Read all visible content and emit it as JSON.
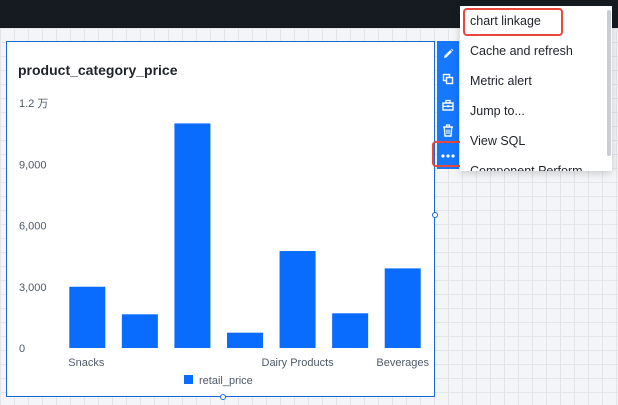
{
  "panel": {
    "title": "product_category_price"
  },
  "toolbar": {
    "buttons": [
      {
        "name": "edit",
        "icon": "pencil-icon"
      },
      {
        "name": "copy",
        "icon": "copy-icon"
      },
      {
        "name": "toolbox",
        "icon": "toolbox-icon"
      },
      {
        "name": "delete",
        "icon": "trash-icon"
      },
      {
        "name": "more",
        "icon": "ellipsis-icon"
      }
    ]
  },
  "menu": {
    "items": [
      {
        "label": "chart linkage"
      },
      {
        "label": "Cache and refresh"
      },
      {
        "label": "Metric alert"
      },
      {
        "label": "Jump to..."
      },
      {
        "label": "View SQL"
      },
      {
        "label": "Component Perform..."
      }
    ]
  },
  "colors": {
    "accent": "#1677ff",
    "bar": "#0a6cff",
    "highlight": "#e8483b",
    "topbar": "#161b22"
  },
  "chart_data": {
    "type": "bar",
    "title": "product_category_price",
    "categories": [
      "Snacks",
      "",
      "",
      "",
      "Dairy Products",
      "",
      "Beverages"
    ],
    "series": [
      {
        "name": "retail_price",
        "values": [
          3000,
          1650,
          11000,
          750,
          4750,
          1700,
          3900
        ]
      }
    ],
    "y_ticks": [
      {
        "value": 0,
        "label": "0"
      },
      {
        "value": 3000,
        "label": "3,000"
      },
      {
        "value": 6000,
        "label": "6,000"
      },
      {
        "value": 9000,
        "label": "9,000"
      },
      {
        "value": 12000,
        "label": "1.2 万"
      }
    ],
    "ylim": [
      0,
      12000
    ],
    "grid": false,
    "legend": "bottom"
  }
}
